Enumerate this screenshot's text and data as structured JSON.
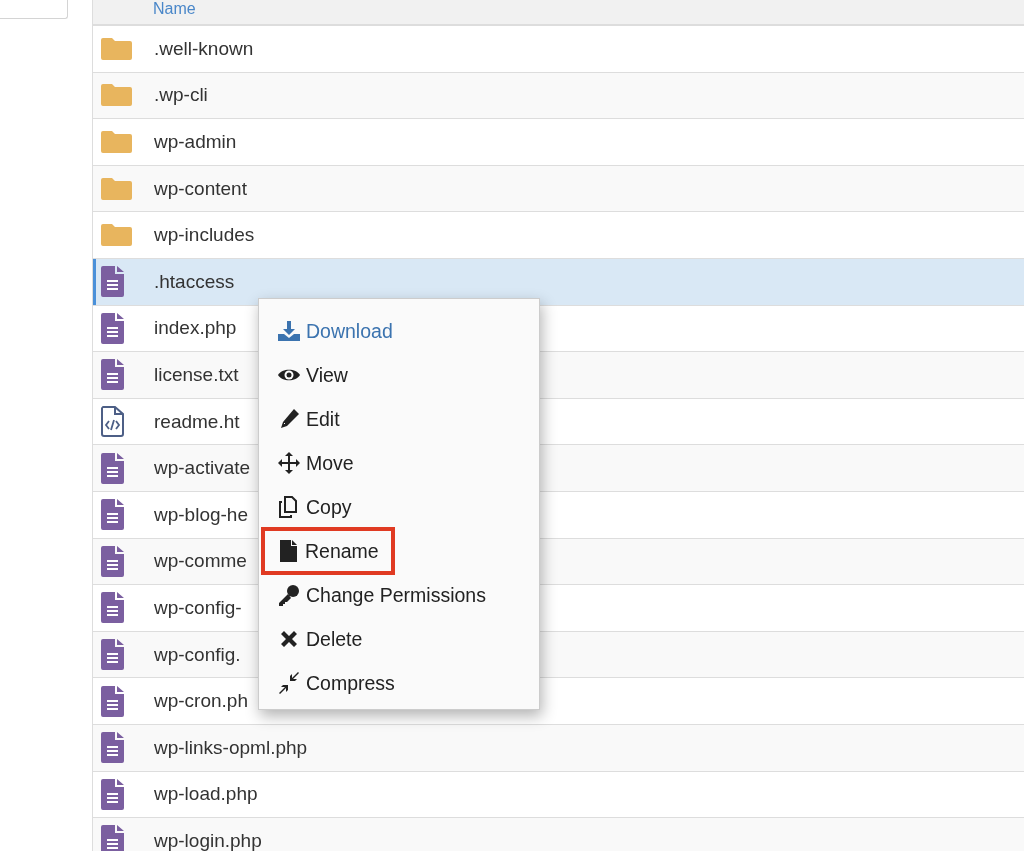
{
  "table": {
    "columns": [
      {
        "label": "Name"
      }
    ],
    "rows": [
      {
        "name": ".well-known",
        "kind": "folder",
        "selected": false
      },
      {
        "name": ".wp-cli",
        "kind": "folder",
        "selected": false
      },
      {
        "name": "wp-admin",
        "kind": "folder",
        "selected": false
      },
      {
        "name": "wp-content",
        "kind": "folder",
        "selected": false
      },
      {
        "name": "wp-includes",
        "kind": "folder",
        "selected": false
      },
      {
        "name": ".htaccess",
        "kind": "file",
        "selected": true
      },
      {
        "name": "index.php",
        "kind": "file",
        "selected": false
      },
      {
        "name": "license.txt",
        "kind": "file",
        "selected": false
      },
      {
        "name": "readme.ht",
        "kind": "code",
        "selected": false
      },
      {
        "name": "wp-activate",
        "kind": "file",
        "selected": false
      },
      {
        "name": "wp-blog-he",
        "kind": "file",
        "selected": false
      },
      {
        "name": "wp-comme",
        "kind": "file",
        "selected": false
      },
      {
        "name": "wp-config-",
        "kind": "file",
        "selected": false
      },
      {
        "name": "wp-config.",
        "kind": "file",
        "selected": false
      },
      {
        "name": "wp-cron.ph",
        "kind": "file",
        "selected": false
      },
      {
        "name": "wp-links-opml.php",
        "kind": "file",
        "selected": false
      },
      {
        "name": "wp-load.php",
        "kind": "file",
        "selected": false
      },
      {
        "name": "wp-login.php",
        "kind": "file",
        "selected": false
      }
    ]
  },
  "context_menu": {
    "items": [
      {
        "label": "Download",
        "primary": true,
        "highlighted": false
      },
      {
        "label": "View",
        "primary": false,
        "highlighted": false
      },
      {
        "label": "Edit",
        "primary": false,
        "highlighted": false
      },
      {
        "label": "Move",
        "primary": false,
        "highlighted": false
      },
      {
        "label": "Copy",
        "primary": false,
        "highlighted": false
      },
      {
        "label": "Rename",
        "primary": false,
        "highlighted": true
      },
      {
        "label": "Change Permissions",
        "primary": false,
        "highlighted": false
      },
      {
        "label": "Delete",
        "primary": false,
        "highlighted": false
      },
      {
        "label": "Compress",
        "primary": false,
        "highlighted": false
      }
    ]
  }
}
